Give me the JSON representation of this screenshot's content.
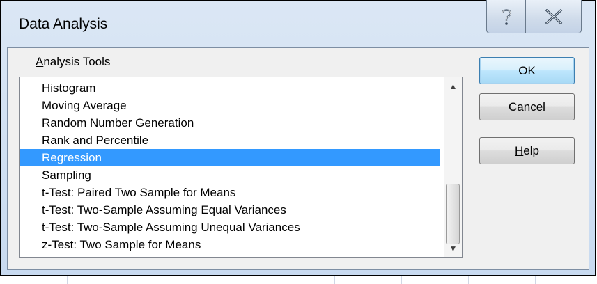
{
  "dialog": {
    "title": "Data Analysis",
    "help_button_icon": "question-mark-icon",
    "close_button_icon": "close-x-icon"
  },
  "analysis_tools": {
    "label_accel": "A",
    "label_rest": "nalysis Tools",
    "items": [
      "Histogram",
      "Moving Average",
      "Random Number Generation",
      "Rank and Percentile",
      "Regression",
      "Sampling",
      "t-Test: Paired Two Sample for Means",
      "t-Test: Two-Sample Assuming Equal Variances",
      "t-Test: Two-Sample Assuming Unequal Variances",
      "z-Test: Two Sample for Means"
    ],
    "selected": "Regression"
  },
  "buttons": {
    "ok": "OK",
    "cancel": "Cancel",
    "help_accel": "H",
    "help_rest": "elp"
  },
  "colors": {
    "selection": "#3399ff",
    "default_button_border": "#3c7fb1",
    "title_background": "#cfdff2"
  }
}
